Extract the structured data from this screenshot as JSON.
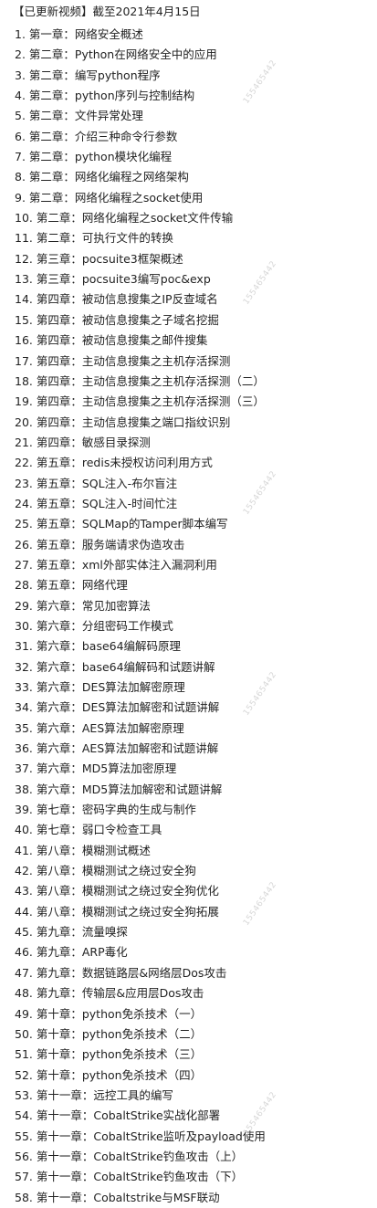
{
  "header": "【已更新视频】截至2021年4月15日",
  "watermark": "155465442",
  "items": [
    "1. 第一章：网络安全概述",
    "2. 第二章：Python在网络安全中的应用",
    "3. 第二章：编写python程序",
    "4. 第二章：python序列与控制结构",
    "5. 第二章：文件异常处理",
    "6. 第二章：介绍三种命令行参数",
    "7. 第二章：python模块化编程",
    "8. 第二章：网络化编程之网络架构",
    "9. 第二章：网络化编程之socket使用",
    "10. 第二章：网络化编程之socket文件传输",
    "11. 第二章：可执行文件的转换",
    "12. 第三章：pocsuite3框架概述",
    "13. 第三章：pocsuite3编写poc&exp",
    "14. 第四章：被动信息搜集之IP反查域名",
    "15. 第四章：被动信息搜集之子域名挖掘",
    "16. 第四章：被动信息搜集之邮件搜集",
    "17. 第四章：主动信息搜集之主机存活探测",
    "18. 第四章：主动信息搜集之主机存活探测（二）",
    "19. 第四章：主动信息搜集之主机存活探测（三）",
    "20. 第四章：主动信息搜集之端口指纹识别",
    "21. 第四章：敏感目录探测",
    "22. 第五章：redis未授权访问利用方式",
    "23. 第五章：SQL注入-布尔盲注",
    "24. 第五章：SQL注入-时间忙注",
    "25. 第五章：SQLMap的Tamper脚本编写",
    "26. 第五章：服务端请求伪造攻击",
    "27. 第五章：xml外部实体注入漏洞利用",
    "28. 第五章：网络代理",
    "29. 第六章：常见加密算法",
    "30. 第六章：分组密码工作模式",
    "31. 第六章：base64编解码原理",
    "32. 第六章：base64编解码和试题讲解",
    "33. 第六章：DES算法加解密原理",
    "34. 第六章：DES算法加解密和试题讲解",
    "35. 第六章：AES算法加解密原理",
    "36. 第六章：AES算法加解密和试题讲解",
    "37. 第六章：MD5算法加密原理",
    "38. 第六章：MD5算法加解密和试题讲解",
    "39. 第七章：密码字典的生成与制作",
    "40. 第七章：弱口令检查工具",
    "41. 第八章：模糊测试概述",
    "42. 第八章：模糊测试之绕过安全狗",
    "43. 第八章：模糊测试之绕过安全狗优化",
    "44. 第八章：模糊测试之绕过安全狗拓展",
    "45. 第九章：流量嗅探",
    "46. 第九章：ARP毒化",
    "47. 第九章：数据链路层&网络层Dos攻击",
    "48. 第九章：传输层&应用层Dos攻击",
    "49. 第十章：python免杀技术（一）",
    "50. 第十章：python免杀技术（二）",
    "51. 第十章：python免杀技术（三）",
    "52. 第十章：python免杀技术（四）",
    "53. 第十一章：远控工具的编写",
    "54. 第十一章：CobaltStrike实战化部署",
    "55. 第十一章：CobaltStrike监听及payload使用",
    "56. 第十一章：CobaltStrike钓鱼攻击（上）",
    "57. 第十一章：CobaltStrike钓鱼攻击（下）",
    "58. 第十一章：Cobaltstrike与MSF联动"
  ]
}
